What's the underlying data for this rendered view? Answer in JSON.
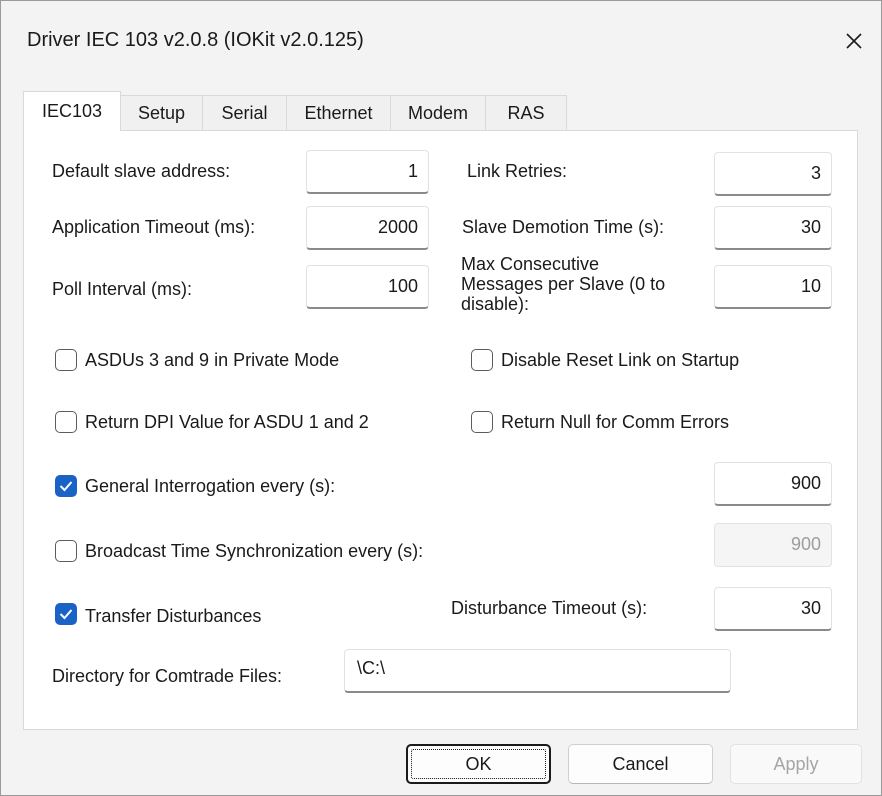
{
  "window": {
    "title": "Driver IEC 103 v2.0.8 (IOKit v2.0.125)",
    "close_icon": "close-icon"
  },
  "tabs": [
    {
      "label": "IEC103",
      "active": true
    },
    {
      "label": "Setup",
      "active": false
    },
    {
      "label": "Serial",
      "active": false
    },
    {
      "label": "Ethernet",
      "active": false
    },
    {
      "label": "Modem",
      "active": false
    },
    {
      "label": "RAS",
      "active": false
    }
  ],
  "fields": {
    "default_slave_address": {
      "label": "Default slave address:",
      "value": "1"
    },
    "link_retries": {
      "label": "Link Retries:",
      "value": "3"
    },
    "application_timeout": {
      "label": "Application Timeout (ms):",
      "value": "2000"
    },
    "slave_demotion_time": {
      "label": "Slave Demotion Time (s):",
      "value": "30"
    },
    "poll_interval": {
      "label": "Poll Interval (ms):",
      "value": "100"
    },
    "max_consecutive": {
      "label": "Max Consecutive Messages per Slave (0 to disable):",
      "value": "10"
    },
    "general_interrogation": {
      "label": "General Interrogation every (s):",
      "value": "900"
    },
    "broadcast_time_sync": {
      "label": "Broadcast Time Synchronization every (s):",
      "value": "900"
    },
    "disturbance_timeout": {
      "label": "Disturbance Timeout (s):",
      "value": "30"
    },
    "comtrade_directory": {
      "label": "Directory for Comtrade Files:",
      "value": "\\C:\\"
    }
  },
  "checkboxes": {
    "asdus_private_mode": {
      "label": "ASDUs 3 and 9 in Private Mode",
      "checked": false
    },
    "disable_reset_link": {
      "label": "Disable Reset Link on Startup",
      "checked": false
    },
    "return_dpi_value": {
      "label": "Return DPI Value for ASDU 1 and 2",
      "checked": false
    },
    "return_null": {
      "label": "Return Null for Comm Errors",
      "checked": false
    },
    "general_interrogation": {
      "checked": true
    },
    "broadcast_time_sync": {
      "checked": false
    },
    "transfer_disturbances": {
      "label": "Transfer Disturbances",
      "checked": true
    }
  },
  "buttons": {
    "ok": "OK",
    "cancel": "Cancel",
    "apply": "Apply"
  },
  "colors": {
    "accent": "#1a63c6",
    "disabled_text": "#9d9d9d"
  }
}
